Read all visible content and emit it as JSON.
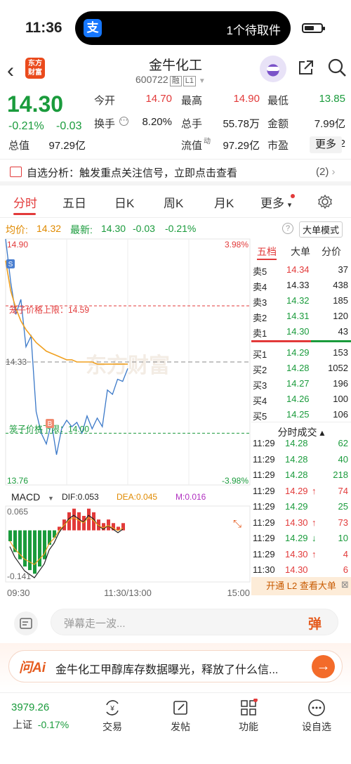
{
  "status": {
    "time": "11:36",
    "app_icon": "支",
    "pill_text": "1个待取件"
  },
  "header": {
    "logo_line1": "东方",
    "logo_line2": "财富",
    "name": "金牛化工",
    "code": "600722",
    "tag1": "融",
    "tag2": "L1"
  },
  "quote": {
    "price": "14.30",
    "pct": "-0.21%",
    "chg": "-0.03",
    "fields": [
      {
        "label": "今开",
        "value": "14.70",
        "color": "red"
      },
      {
        "label": "最高",
        "value": "14.90",
        "color": "red"
      },
      {
        "label": "最低",
        "value": "13.85",
        "color": "green"
      },
      {
        "label": "换手",
        "value": "8.20%",
        "color": "black"
      },
      {
        "label": "总手",
        "value": "55.78万",
        "color": "black"
      },
      {
        "label": "金额",
        "value": "7.99亿",
        "color": "black"
      },
      {
        "label": "总值",
        "value": "97.29亿",
        "color": "black"
      },
      {
        "label": "流值",
        "value": "97.29亿",
        "color": "black"
      },
      {
        "label": "市盈",
        "value": "202.52",
        "color": "black"
      }
    ],
    "pe_sup": "动",
    "more": "更多"
  },
  "alert": {
    "text": "自选分析：触发重点关注信号，立即点击查看",
    "count": "(2)"
  },
  "tabs": [
    "分时",
    "五日",
    "日K",
    "周K",
    "月K",
    "更多"
  ],
  "info": {
    "avg_label": "均价:",
    "avg": "14.32",
    "last_label": "最新:",
    "last": "14.30",
    "chg": "-0.03",
    "pct": "-0.21%",
    "bigorder": "大单模式"
  },
  "chart": {
    "ymax": "14.90",
    "ymin": "13.76",
    "pmax": "3.98%",
    "pmin": "-3.98%",
    "mid": "14.33",
    "upper_label": "笼子价格上限：14.59",
    "lower_label": "笼子价格下限：14.00",
    "watermark": "东方财富",
    "t_start": "09:30",
    "t_mid": "11:30/13:00",
    "t_end": "15:00",
    "macd_label": "MACD",
    "dif": "DIF:0.053",
    "dea": "DEA:0.045",
    "m": "M:0.016",
    "macd_top": "0.065",
    "macd_bot": "-0.141",
    "mark_s": "S",
    "mark_b": "B"
  },
  "chart_data": {
    "type": "line",
    "title": "",
    "ylim": [
      13.76,
      14.9
    ],
    "x_labels": [
      "09:30",
      "11:30/13:00",
      "15:00"
    ],
    "series": [
      {
        "name": "最新",
        "values": [
          14.9,
          14.7,
          14.55,
          14.62,
          14.4,
          14.45,
          14.1,
          14.0,
          13.95,
          14.05,
          13.9,
          14.02,
          14.06,
          14.03,
          14.05,
          14.0,
          14.08,
          14.02,
          14.07,
          14.03,
          14.2,
          14.18,
          14.25,
          14.24,
          14.3
        ]
      },
      {
        "name": "均价",
        "values": [
          14.8,
          14.66,
          14.58,
          14.52,
          14.48,
          14.45,
          14.42,
          14.4,
          14.38,
          14.37,
          14.36,
          14.35,
          14.34,
          14.34,
          14.33,
          14.33,
          14.33,
          14.33,
          14.32,
          14.32,
          14.32,
          14.32,
          14.32,
          14.32,
          14.32
        ]
      }
    ]
  },
  "rpanel": {
    "tabs": [
      "五档",
      "大单",
      "分价"
    ],
    "asks": [
      {
        "l": "卖5",
        "p": "14.34",
        "v": "37"
      },
      {
        "l": "卖4",
        "p": "14.33",
        "v": "438"
      },
      {
        "l": "卖3",
        "p": "14.32",
        "v": "185"
      },
      {
        "l": "卖2",
        "p": "14.31",
        "v": "120"
      },
      {
        "l": "卖1",
        "p": "14.30",
        "v": "43"
      }
    ],
    "bids": [
      {
        "l": "买1",
        "p": "14.29",
        "v": "153"
      },
      {
        "l": "买2",
        "p": "14.28",
        "v": "1052"
      },
      {
        "l": "买3",
        "p": "14.27",
        "v": "196"
      },
      {
        "l": "买4",
        "p": "14.26",
        "v": "100"
      },
      {
        "l": "买5",
        "p": "14.25",
        "v": "106"
      }
    ],
    "trades_title": "分时成交",
    "trades": [
      {
        "t": "11:29",
        "p": "14.28",
        "v": "62",
        "c": "green",
        "a": ""
      },
      {
        "t": "11:29",
        "p": "14.28",
        "v": "40",
        "c": "green",
        "a": ""
      },
      {
        "t": "11:29",
        "p": "14.28",
        "v": "218",
        "c": "green",
        "a": ""
      },
      {
        "t": "11:29",
        "p": "14.29",
        "v": "74",
        "c": "red",
        "a": "↑"
      },
      {
        "t": "11:29",
        "p": "14.29",
        "v": "25",
        "c": "green",
        "a": ""
      },
      {
        "t": "11:29",
        "p": "14.30",
        "v": "73",
        "c": "red",
        "a": "↑"
      },
      {
        "t": "11:29",
        "p": "14.29",
        "v": "10",
        "c": "green",
        "a": "↓"
      },
      {
        "t": "11:29",
        "p": "14.30",
        "v": "4",
        "c": "red",
        "a": "↑"
      },
      {
        "t": "11:30",
        "p": "14.30",
        "v": "6",
        "c": "red",
        "a": ""
      }
    ],
    "kaitong": "开通 L2 查看大单"
  },
  "danmu": {
    "placeholder": "弹幕走一波...",
    "btn": "弹"
  },
  "ai": {
    "logo": "问Ai",
    "text": "金牛化工甲醇库存数据曝光，释放了什么信...",
    "go": "→"
  },
  "bottom": {
    "index_value": "3979.26",
    "index_name": "上证",
    "index_pct": "-0.17%",
    "items": [
      "交易",
      "发帖",
      "功能",
      "设自选"
    ]
  }
}
